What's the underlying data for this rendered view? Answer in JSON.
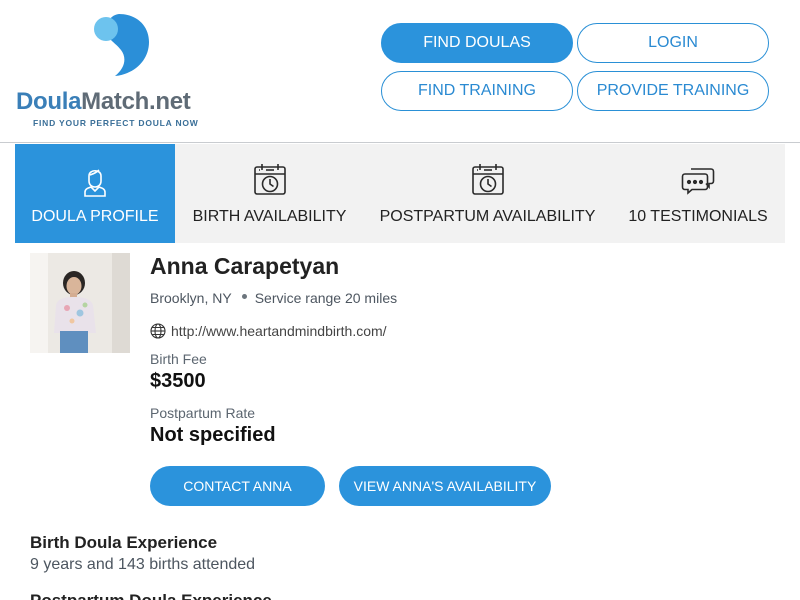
{
  "brand": {
    "name_part1": "Doula",
    "name_part2": "Match.net",
    "tagline": "FIND YOUR PERFECT DOULA NOW",
    "colors": {
      "primary": "#2b93dc",
      "logo_blue": "#3a7fb8",
      "logo_gray": "#5f6b76",
      "tab_bg": "#f2f2f2"
    }
  },
  "nav": {
    "find_doulas": "FIND DOULAS",
    "login": "LOGIN",
    "find_training": "FIND TRAINING",
    "provide_training": "PROVIDE TRAINING"
  },
  "tabs": [
    {
      "label": "DOULA PROFILE",
      "icon": "doula-person-icon",
      "active": true
    },
    {
      "label": "BIRTH AVAILABILITY",
      "icon": "calendar-clock-icon",
      "active": false
    },
    {
      "label": "POSTPARTUM AVAILABILITY",
      "icon": "calendar-clock-icon",
      "active": false
    },
    {
      "label": "10 TESTIMONIALS",
      "icon": "chat-bubbles-icon",
      "active": false
    }
  ],
  "profile": {
    "name": "Anna Carapetyan",
    "location": "Brooklyn, NY",
    "service_range": "Service range 20 miles",
    "website": "http://www.heartandmindbirth.com/",
    "birth_fee_label": "Birth Fee",
    "birth_fee": "$3500",
    "postpartum_label": "Postpartum Rate",
    "postpartum_rate": "Not specified",
    "contact_button": "CONTACT ANNA",
    "availability_button": "VIEW ANNA'S AVAILABILITY"
  },
  "sections": {
    "birth_experience_title": "Birth Doula Experience",
    "birth_experience_text": "9 years and 143 births attended",
    "postpartum_experience_title": "Postpartum Doula Experience"
  }
}
